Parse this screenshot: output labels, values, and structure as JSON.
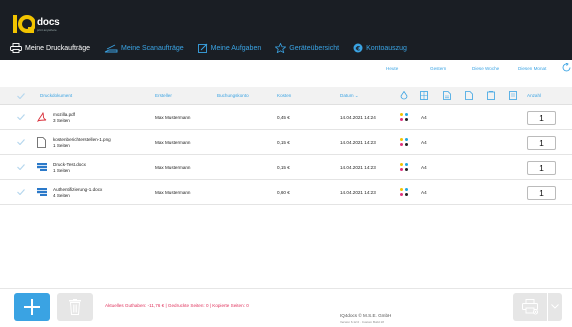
{
  "app": {
    "logo_text": "docs",
    "logo_sub": "print anywhere"
  },
  "nav": {
    "items": [
      {
        "label": "Meine Druckaufträge",
        "active": true,
        "icon": "printer-icon"
      },
      {
        "label": "Meine Scanaufträge",
        "active": false,
        "icon": "scanner-icon"
      },
      {
        "label": "Meine Aufgaben",
        "active": false,
        "icon": "edit-icon"
      },
      {
        "label": "Geräteübersicht",
        "active": false,
        "icon": "star-icon"
      },
      {
        "label": "Kontoauszug",
        "active": false,
        "icon": "euro-icon"
      }
    ]
  },
  "filters": {
    "today": "Heute",
    "yesterday": "Gestern",
    "this_week": "Diese Woche",
    "this_month": "Diesen Monat"
  },
  "table": {
    "headers": {
      "document": "Druckdokument",
      "creator": "Ersteller",
      "booking_account": "Buchungskonto",
      "cost": "Kosten",
      "date": "Datum ⌄",
      "quantity": "Anzahl"
    },
    "rows": [
      {
        "file": "mozilla.pdf",
        "pages": "3 Seiten",
        "type": "pdf",
        "creator": "Max Mustermann",
        "cost": "0,45 €",
        "date": "14.04.2021 14:24",
        "format": "A4",
        "quantity": "1"
      },
      {
        "file": "kostenberichterstellen-1.png",
        "pages": "1 Seiten",
        "type": "file",
        "creator": "Max Mustermann",
        "cost": "0,15 €",
        "date": "14.04.2021 14:23",
        "format": "A4",
        "quantity": "1"
      },
      {
        "file": "Druck-Test.docx",
        "pages": "1 Seiten",
        "type": "docx",
        "creator": "Max Mustermann",
        "cost": "0,15 €",
        "date": "14.04.2021 14:23",
        "format": "A4",
        "quantity": "1"
      },
      {
        "file": "Authentifizierung-1.docx",
        "pages": "4 Seiten",
        "type": "docx",
        "creator": "Max Mustermann",
        "cost": "0,60 €",
        "date": "14.04.2021 14:23",
        "format": "A4",
        "quantity": "1"
      }
    ]
  },
  "footer": {
    "status": "Aktuelles Guthaben: -11,76 € | Gedruckte Seiten: 0 | Kopierte Seiten: 0",
    "copyright": "IQ4docs © M.S.E. GmbH",
    "version": "Version 6.12.0 · Custom Build 18"
  },
  "colors": {
    "accent": "#3aa3e3",
    "topbar": "#1a1e24",
    "status_text": "#e0325c",
    "logo_yellow": "#f2c400"
  }
}
